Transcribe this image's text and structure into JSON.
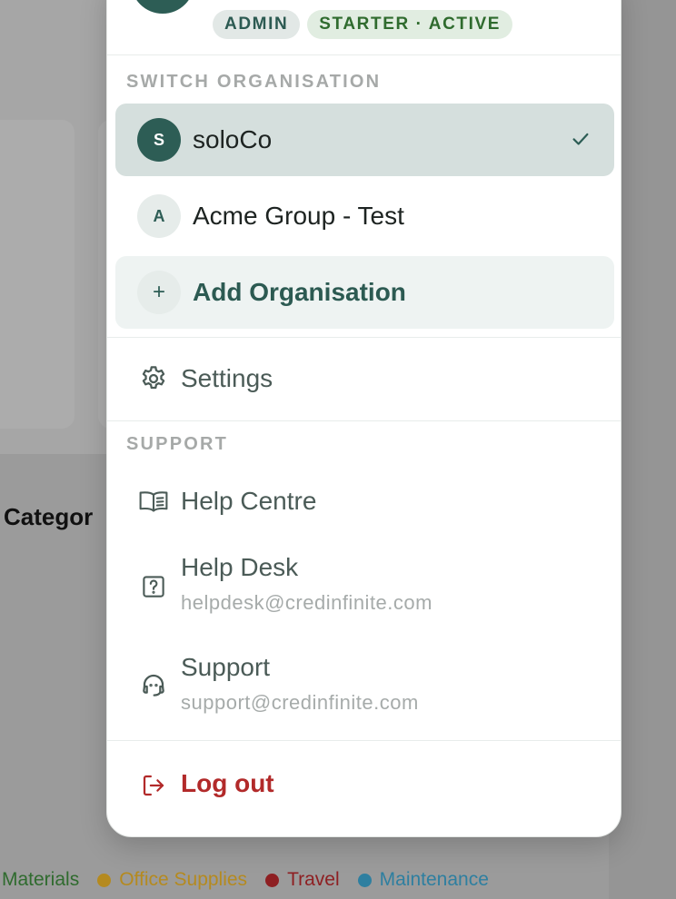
{
  "background": {
    "heading": "Categor",
    "legend": [
      {
        "label": "Materials",
        "color": "#2f6b2e"
      },
      {
        "label": "Office Supplies",
        "color": "#b58a1f"
      },
      {
        "label": "Travel",
        "color": "#8e1f22"
      },
      {
        "label": "Maintenance",
        "color": "#2e7fa0"
      }
    ]
  },
  "account": {
    "badges": [
      "ADMIN",
      "STARTER · ACTIVE"
    ]
  },
  "switch_org": {
    "label": "SWITCH ORGANISATION",
    "orgs": [
      {
        "initial": "S",
        "name": "soloCo",
        "selected": true
      },
      {
        "initial": "A",
        "name": "Acme Group - Test",
        "selected": false
      }
    ],
    "add_label": "Add Organisation",
    "add_icon": "+"
  },
  "menu": {
    "settings": "Settings"
  },
  "support": {
    "label": "SUPPORT",
    "help_centre": "Help Centre",
    "help_desk": {
      "label": "Help Desk",
      "email": "helpdesk@credinfinite.com"
    },
    "support": {
      "label": "Support",
      "email": "support@credinfinite.com"
    }
  },
  "logout": "Log out",
  "colors": {
    "accent": "#2d5d55",
    "danger": "#b22a2a"
  }
}
